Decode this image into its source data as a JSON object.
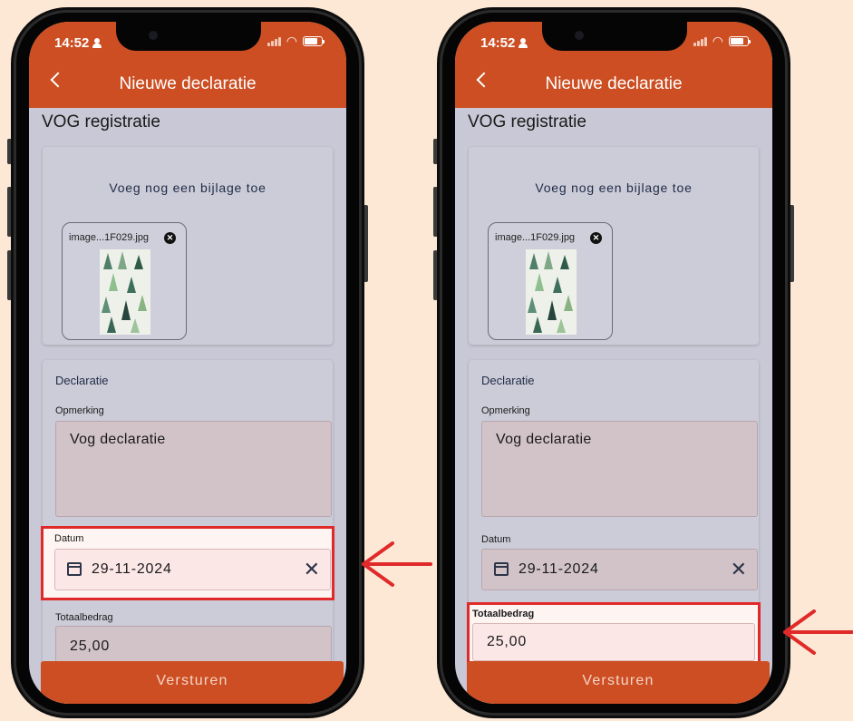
{
  "status": {
    "time": "14:52"
  },
  "header": {
    "title": "Nieuwe declaratie"
  },
  "page": {
    "section_title": "VOG registratie"
  },
  "attachments": {
    "add_label": "Voeg nog een bijlage toe",
    "file_name": "image...1F029.jpg"
  },
  "form": {
    "heading": "Declaratie",
    "remark_label": "Opmerking",
    "remark_value": "Vog declaratie",
    "date_label": "Datum",
    "date_value": "29-11-2024",
    "amount_label": "Totaalbedrag",
    "amount_value": "25,00"
  },
  "submit_label": "Versturen",
  "colors": {
    "background": "#fde8d6",
    "header": "#cc4e22",
    "highlight": "#e02a2a"
  },
  "icons": [
    "back-arrow-icon",
    "calendar-icon",
    "clear-icon",
    "remove-attachment-icon",
    "person-icon",
    "wifi-icon",
    "battery-icon"
  ]
}
